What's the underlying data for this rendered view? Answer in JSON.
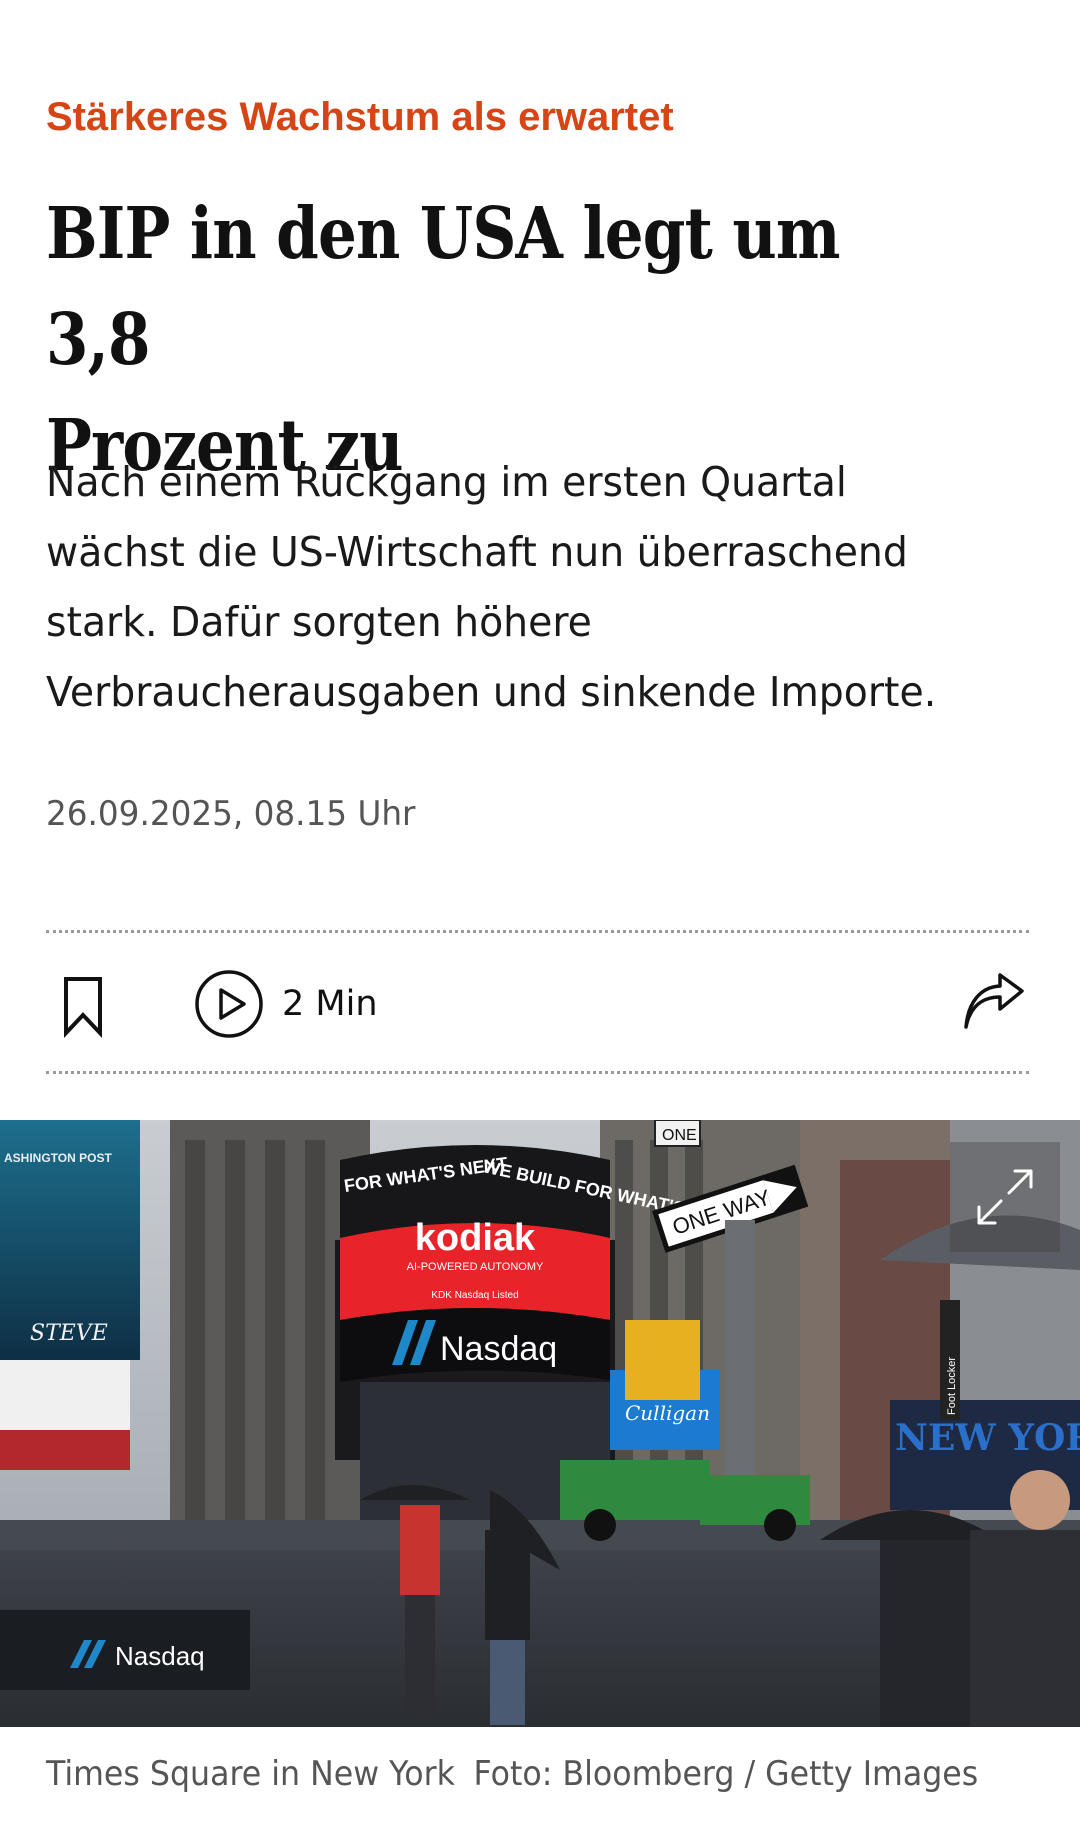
{
  "article": {
    "kicker": "Stärkeres Wachstum als erwartet",
    "headline_line1": "BIP in den USA legt um 3,8",
    "headline_line2": "Prozent zu",
    "intro_line1": "Nach einem Rückgang im ersten Quartal",
    "intro_line2": "wächst die US-Wirtschaft nun überraschend",
    "intro_line3": "stark. Dafür sorgten höhere",
    "intro_line4": "Verbraucherausgaben und sinkende Importe.",
    "date": "26.09.2025, 08.15 Uhr"
  },
  "toolbar": {
    "bookmark_icon": "bookmark-icon",
    "play_icon": "play-circle-icon",
    "audio_duration": "2 Min",
    "share_icon": "share-arrow-icon"
  },
  "image": {
    "expand_icon": "expand-diagonal-icon",
    "signs": {
      "kodiak": "kodiak",
      "ai_powered": "AI-POWERED AUTONOMY",
      "kdk": "KDK  Nasdaq Listed",
      "nasdaq_main": "Nasdaq",
      "tower_text_left": "FOR WHAT'S NEXT",
      "tower_text_right": "WE BUILD FOR WHAT'S",
      "one_way": "ONE WAY",
      "one": "ONE",
      "new_york": "NEW YORK",
      "steve": "STEVE",
      "washington_post": "ASHINGTON POST",
      "barrier_nasdaq": "Nasdaq",
      "culligan": "Culligan",
      "foot_locker": "Foot Locker"
    },
    "caption": "Times Square in New York",
    "credit": "Foto: Bloomberg / Getty Images"
  },
  "colors": {
    "kicker": "#d64515",
    "text": "#111111",
    "meta": "#555555",
    "kodiak_red": "#e8242a",
    "new_york_blue": "#2a6fc9"
  }
}
